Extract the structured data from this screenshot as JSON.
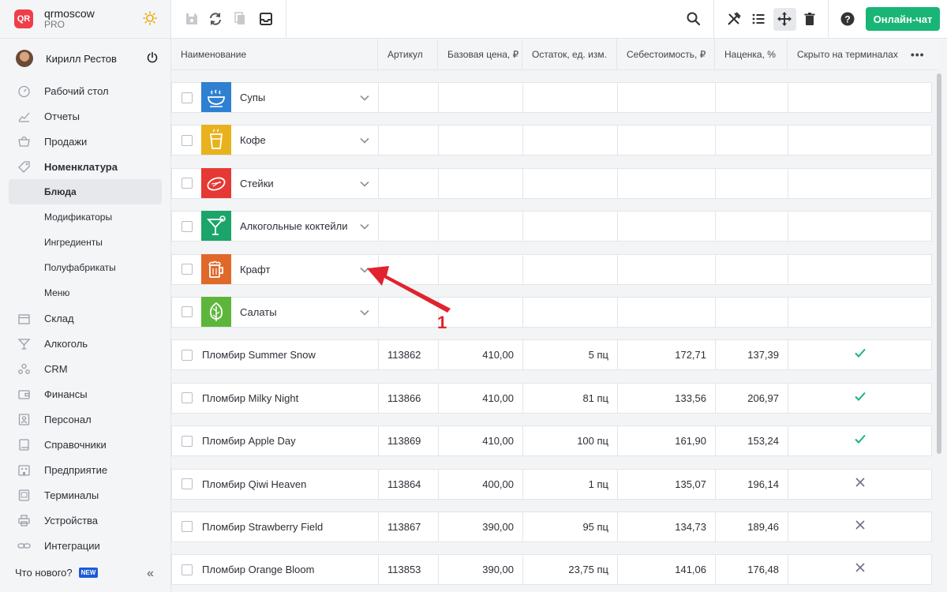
{
  "brand": {
    "logo_text": "QR",
    "name": "qrmoscow",
    "plan": "PRO"
  },
  "user": {
    "name": "Кирилл Рестов"
  },
  "nav": {
    "items": [
      {
        "label": "Рабочий стол",
        "icon": "dashboard-icon"
      },
      {
        "label": "Отчеты",
        "icon": "reports-icon"
      },
      {
        "label": "Продажи",
        "icon": "basket-icon"
      },
      {
        "label": "Номенклатура",
        "icon": "tag-icon"
      }
    ],
    "sub_items": [
      {
        "label": "Блюда"
      },
      {
        "label": "Модификаторы"
      },
      {
        "label": "Ингредиенты"
      },
      {
        "label": "Полуфабрикаты"
      },
      {
        "label": "Меню"
      }
    ],
    "items_after": [
      {
        "label": "Склад",
        "icon": "box-icon"
      },
      {
        "label": "Алкоголь",
        "icon": "cocktail-icon"
      },
      {
        "label": "CRM",
        "icon": "crm-icon"
      },
      {
        "label": "Финансы",
        "icon": "wallet-icon"
      },
      {
        "label": "Персонал",
        "icon": "staff-icon"
      },
      {
        "label": "Справочники",
        "icon": "book-icon"
      },
      {
        "label": "Предприятие",
        "icon": "building-icon"
      },
      {
        "label": "Терминалы",
        "icon": "terminal-icon"
      },
      {
        "label": "Устройства",
        "icon": "printer-icon"
      },
      {
        "label": "Интеграции",
        "icon": "link-icon"
      }
    ],
    "whats_new": "Что нового?",
    "new_badge": "NEW"
  },
  "toolbar": {
    "chat_label": "Онлайн-чат"
  },
  "table": {
    "headers": [
      "Наименование",
      "Артикул",
      "Базовая цена, ₽",
      "Остаток, ед. изм.",
      "Себестоимость, ₽",
      "Наценка, %",
      "Скрыто на терминалах"
    ],
    "categories": [
      {
        "name": "Супы",
        "color": "#2f80d1",
        "icon": "soup-icon"
      },
      {
        "name": "Кофе",
        "color": "#e8b21f",
        "icon": "coffee-icon"
      },
      {
        "name": "Стейки",
        "color": "#e53935",
        "icon": "steak-icon"
      },
      {
        "name": "Алкогольные коктейли",
        "color": "#1ba56a",
        "icon": "cocktail-icon"
      },
      {
        "name": "Крафт",
        "color": "#e0692a",
        "icon": "beer-icon"
      },
      {
        "name": "Салаты",
        "color": "#5db63a",
        "icon": "leaf-icon"
      }
    ],
    "items": [
      {
        "name": "Пломбир Summer Snow",
        "sku": "113862",
        "price": "410,00",
        "stock": "5 пц",
        "cost": "172,71",
        "markup": "137,39",
        "hidden": true
      },
      {
        "name": "Пломбир Milky Night",
        "sku": "113866",
        "price": "410,00",
        "stock": "81 пц",
        "cost": "133,56",
        "markup": "206,97",
        "hidden": true
      },
      {
        "name": "Пломбир Apple Day",
        "sku": "113869",
        "price": "410,00",
        "stock": "100 пц",
        "cost": "161,90",
        "markup": "153,24",
        "hidden": true
      },
      {
        "name": "Пломбир Qiwi Heaven",
        "sku": "113864",
        "price": "400,00",
        "stock": "1 пц",
        "cost": "135,07",
        "markup": "196,14",
        "hidden": false
      },
      {
        "name": "Пломбир Strawberry Field",
        "sku": "113867",
        "price": "390,00",
        "stock": "95 пц",
        "cost": "134,73",
        "markup": "189,46",
        "hidden": false
      },
      {
        "name": "Пломбир Orange Bloom",
        "sku": "113853",
        "price": "390,00",
        "stock": "23,75 пц",
        "cost": "141,06",
        "markup": "176,48",
        "hidden": false
      }
    ]
  },
  "annotation": {
    "label": "1",
    "color": "#e0232e"
  }
}
